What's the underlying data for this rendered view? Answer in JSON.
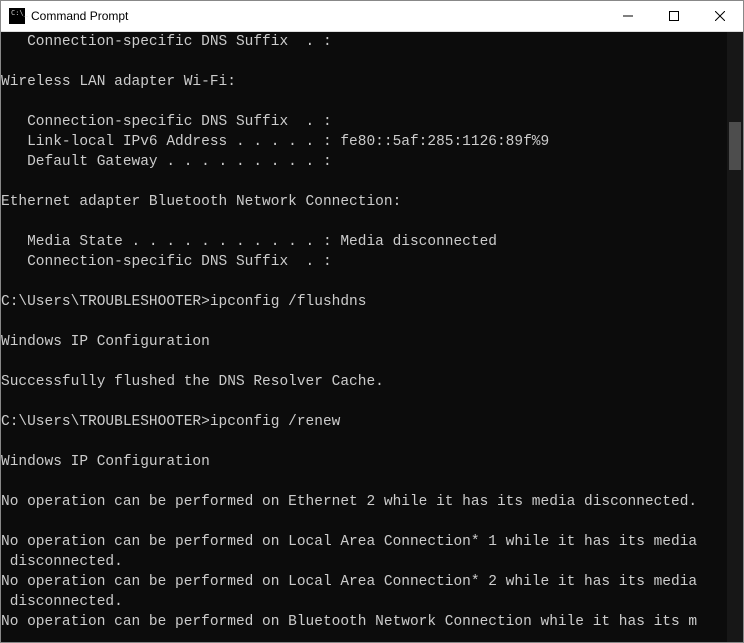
{
  "window": {
    "title": "Command Prompt"
  },
  "terminal": {
    "lines": [
      "   Connection-specific DNS Suffix  . :",
      "",
      "Wireless LAN adapter Wi-Fi:",
      "",
      "   Connection-specific DNS Suffix  . :",
      "   Link-local IPv6 Address . . . . . : fe80::5af:285:1126:89f%9",
      "   Default Gateway . . . . . . . . . :",
      "",
      "Ethernet adapter Bluetooth Network Connection:",
      "",
      "   Media State . . . . . . . . . . . : Media disconnected",
      "   Connection-specific DNS Suffix  . :",
      "",
      "C:\\Users\\TROUBLESHOOTER>ipconfig /flushdns",
      "",
      "Windows IP Configuration",
      "",
      "Successfully flushed the DNS Resolver Cache.",
      "",
      "C:\\Users\\TROUBLESHOOTER>ipconfig /renew",
      "",
      "Windows IP Configuration",
      "",
      "No operation can be performed on Ethernet 2 while it has its media disconnected.",
      "",
      "No operation can be performed on Local Area Connection* 1 while it has its media",
      " disconnected.",
      "No operation can be performed on Local Area Connection* 2 while it has its media",
      " disconnected.",
      "No operation can be performed on Bluetooth Network Connection while it has its m"
    ]
  }
}
